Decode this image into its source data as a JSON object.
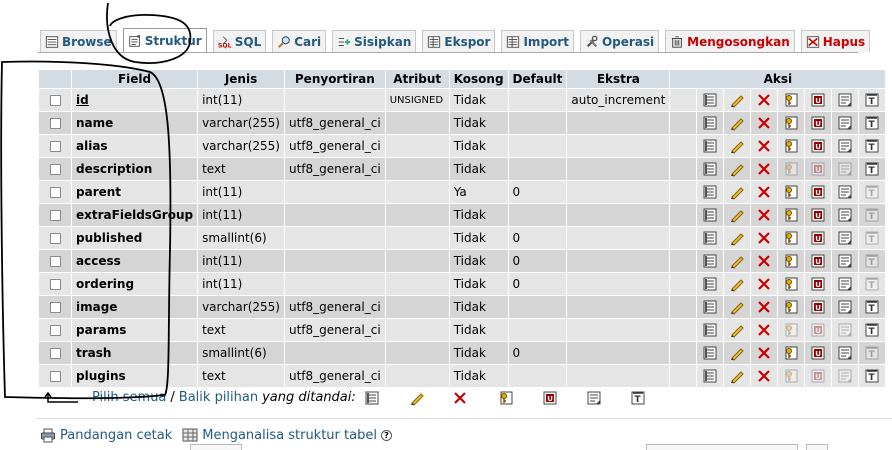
{
  "tabs": [
    {
      "label": "Browse",
      "icon": "browse-icon",
      "active": false,
      "red": false
    },
    {
      "label": "Struktur",
      "icon": "structure-icon",
      "active": true,
      "red": false
    },
    {
      "label": "SQL",
      "icon": "sql-icon",
      "active": false,
      "red": false
    },
    {
      "label": "Cari",
      "icon": "search-icon",
      "active": false,
      "red": false
    },
    {
      "label": "Sisipkan",
      "icon": "insert-icon",
      "active": false,
      "red": false
    },
    {
      "label": "Ekspor",
      "icon": "export-icon",
      "active": false,
      "red": false
    },
    {
      "label": "Import",
      "icon": "import-icon",
      "active": false,
      "red": false
    },
    {
      "label": "Operasi",
      "icon": "operations-icon",
      "active": false,
      "red": false
    },
    {
      "label": "Mengosongkan",
      "icon": "empty-icon",
      "active": false,
      "red": true
    },
    {
      "label": "Hapus",
      "icon": "drop-icon",
      "active": false,
      "red": true
    }
  ],
  "table": {
    "headers": {
      "field": "Field",
      "jenis": "Jenis",
      "penyortiran": "Penyortiran",
      "atribut": "Atribut",
      "kosong": "Kosong",
      "default": "Default",
      "ekstra": "Ekstra",
      "aksi": "Aksi"
    },
    "rows": [
      {
        "field": "id",
        "jenis": "int(11)",
        "penyortiran": "",
        "atribut": "UNSIGNED",
        "kosong": "Tidak",
        "default": "",
        "ekstra": "auto_increment",
        "pk": true,
        "dim": [
          false,
          false,
          false,
          false
        ]
      },
      {
        "field": "name",
        "jenis": "varchar(255)",
        "penyortiran": "utf8_general_ci",
        "atribut": "",
        "kosong": "Tidak",
        "default": "",
        "ekstra": "",
        "pk": false,
        "dim": [
          false,
          false,
          false,
          false
        ]
      },
      {
        "field": "alias",
        "jenis": "varchar(255)",
        "penyortiran": "utf8_general_ci",
        "atribut": "",
        "kosong": "Tidak",
        "default": "",
        "ekstra": "",
        "pk": false,
        "dim": [
          false,
          false,
          false,
          false
        ]
      },
      {
        "field": "description",
        "jenis": "text",
        "penyortiran": "utf8_general_ci",
        "atribut": "",
        "kosong": "Tidak",
        "default": "",
        "ekstra": "",
        "pk": false,
        "dim": [
          true,
          true,
          true,
          false
        ]
      },
      {
        "field": "parent",
        "jenis": "int(11)",
        "penyortiran": "",
        "atribut": "",
        "kosong": "Ya",
        "default": "0",
        "ekstra": "",
        "pk": false,
        "dim": [
          false,
          false,
          false,
          true
        ]
      },
      {
        "field": "extraFieldsGroup",
        "jenis": "int(11)",
        "penyortiran": "",
        "atribut": "",
        "kosong": "Tidak",
        "default": "",
        "ekstra": "",
        "pk": false,
        "dim": [
          false,
          false,
          false,
          true
        ]
      },
      {
        "field": "published",
        "jenis": "smallint(6)",
        "penyortiran": "",
        "atribut": "",
        "kosong": "Tidak",
        "default": "0",
        "ekstra": "",
        "pk": false,
        "dim": [
          false,
          false,
          false,
          true
        ]
      },
      {
        "field": "access",
        "jenis": "int(11)",
        "penyortiran": "",
        "atribut": "",
        "kosong": "Tidak",
        "default": "0",
        "ekstra": "",
        "pk": false,
        "dim": [
          false,
          false,
          false,
          true
        ]
      },
      {
        "field": "ordering",
        "jenis": "int(11)",
        "penyortiran": "",
        "atribut": "",
        "kosong": "Tidak",
        "default": "0",
        "ekstra": "",
        "pk": false,
        "dim": [
          false,
          false,
          false,
          true
        ]
      },
      {
        "field": "image",
        "jenis": "varchar(255)",
        "penyortiran": "utf8_general_ci",
        "atribut": "",
        "kosong": "Tidak",
        "default": "",
        "ekstra": "",
        "pk": false,
        "dim": [
          false,
          false,
          false,
          false
        ]
      },
      {
        "field": "params",
        "jenis": "text",
        "penyortiran": "utf8_general_ci",
        "atribut": "",
        "kosong": "Tidak",
        "default": "",
        "ekstra": "",
        "pk": false,
        "dim": [
          true,
          true,
          true,
          false
        ]
      },
      {
        "field": "trash",
        "jenis": "smallint(6)",
        "penyortiran": "",
        "atribut": "",
        "kosong": "Tidak",
        "default": "0",
        "ekstra": "",
        "pk": false,
        "dim": [
          false,
          false,
          false,
          true
        ]
      },
      {
        "field": "plugins",
        "jenis": "text",
        "penyortiran": "utf8_general_ci",
        "atribut": "",
        "kosong": "Tidak",
        "default": "",
        "ekstra": "",
        "pk": false,
        "dim": [
          true,
          true,
          true,
          false
        ]
      }
    ]
  },
  "bulk": {
    "check_all": "Pilih semua",
    "separator": "/",
    "uncheck_all": "Balik pilihan",
    "with_selected": "yang ditandai:"
  },
  "links": {
    "print_view": "Pandangan cetak",
    "analyze": "Menganalisa struktur tabel"
  },
  "colors": {
    "link": "#235a81",
    "header_bg": "#d3dce3",
    "row_odd": "#e5e5e5",
    "row_even": "#d5d5d5",
    "danger": "#cc0000"
  }
}
